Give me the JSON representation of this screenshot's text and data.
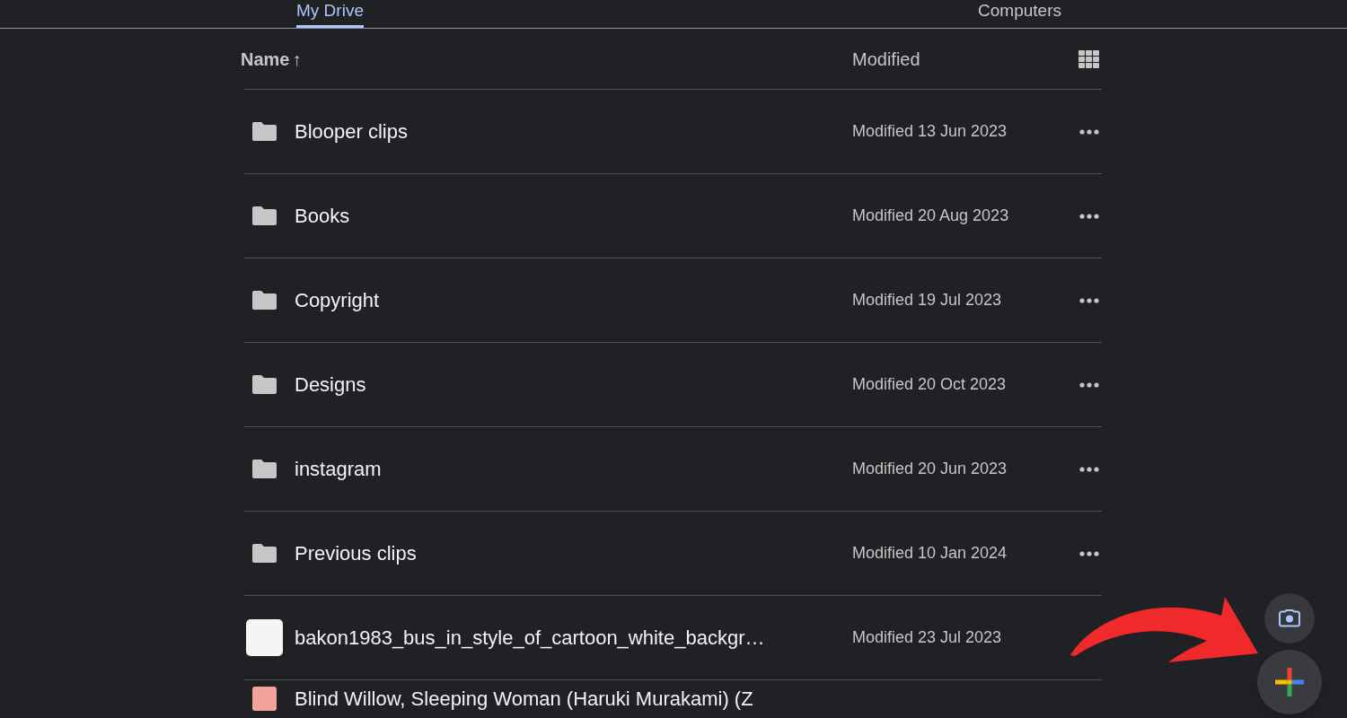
{
  "tabs": [
    {
      "label": "My Drive",
      "selected": true
    },
    {
      "label": "Computers",
      "selected": false
    }
  ],
  "list_header": {
    "name_column": "Name",
    "sort_arrow": "↑",
    "modified_column": "Modified"
  },
  "files": [
    {
      "kind": "folder",
      "name": "Blooper clips",
      "modified": "Modified 13 Jun 2023",
      "menu": true
    },
    {
      "kind": "folder",
      "name": "Books",
      "modified": "Modified 20 Aug 2023",
      "menu": true
    },
    {
      "kind": "folder",
      "name": "Copyright",
      "modified": "Modified 19 Jul 2023",
      "menu": true
    },
    {
      "kind": "folder",
      "name": "Designs",
      "modified": "Modified 20 Oct 2023",
      "menu": true
    },
    {
      "kind": "folder",
      "name": "instagram",
      "modified": "Modified 20 Jun 2023",
      "menu": true
    },
    {
      "kind": "folder",
      "name": "Previous clips",
      "modified": "Modified 10 Jan 2024",
      "menu": true
    },
    {
      "kind": "image",
      "name": "bakon1983_bus_in_style_of_cartoon_white_backgr…",
      "modified": "Modified 23 Jul 2023",
      "menu": false
    },
    {
      "kind": "document",
      "name": "Blind Willow, Sleeping Woman (Haruki Murakami) (Z",
      "menu": false
    }
  ],
  "floating_buttons": [
    {
      "kind": "camera"
    },
    {
      "kind": "new"
    }
  ],
  "annotation": {
    "kind": "arrow"
  }
}
